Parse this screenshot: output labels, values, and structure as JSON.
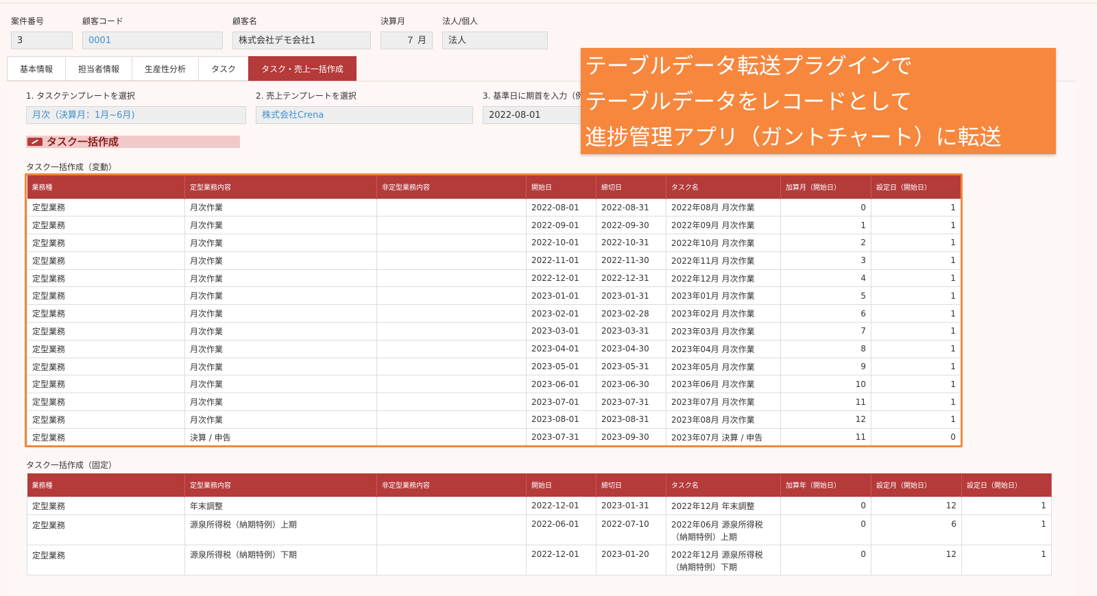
{
  "header": {
    "case_no": {
      "label": "案件番号",
      "value": "3"
    },
    "customer_code": {
      "label": "顧客コード",
      "value": "0001"
    },
    "customer_name": {
      "label": "顧客名",
      "value": "株式会社デモ会社1"
    },
    "closing_month": {
      "label": "決算月",
      "value": "７ 月"
    },
    "entity_type": {
      "label": "法人/個人",
      "value": "法人"
    }
  },
  "tabs": [
    "基本情報",
    "担当者情報",
    "生産性分析",
    "タスク",
    "タスク・売上一括作成"
  ],
  "selectors": {
    "task_template": {
      "label": "1. タスクテンプレートを選択",
      "value": "月次（決算月：1月~6月)"
    },
    "sales_template": {
      "label": "2. 売上テンプレートを選択",
      "value": "株式会社Crena"
    },
    "base_date": {
      "label": "3. 基準日に期首を入力（例",
      "value": "2022-08-01"
    }
  },
  "section_title": "タスク一括作成",
  "callout": {
    "line1": "テーブルデータ転送プラグインで",
    "line2": "テーブルデータをレコードとして",
    "line3": "進捗管理アプリ（ガントチャート）に転送"
  },
  "table_variable": {
    "caption": "タスク一括作成（変動）",
    "headers": [
      "業務種",
      "定型業務内容",
      "非定型業務内容",
      "開始日",
      "締切日",
      "タスク名",
      "加算月（開始日）",
      "設定日（開始日）"
    ],
    "rows": [
      [
        "定型業務",
        "月次作業",
        "",
        "2022-08-01",
        "2022-08-31",
        "2022年08月 月次作業",
        "0",
        "1"
      ],
      [
        "定型業務",
        "月次作業",
        "",
        "2022-09-01",
        "2022-09-30",
        "2022年09月 月次作業",
        "1",
        "1"
      ],
      [
        "定型業務",
        "月次作業",
        "",
        "2022-10-01",
        "2022-10-31",
        "2022年10月 月次作業",
        "2",
        "1"
      ],
      [
        "定型業務",
        "月次作業",
        "",
        "2022-11-01",
        "2022-11-30",
        "2022年11月 月次作業",
        "3",
        "1"
      ],
      [
        "定型業務",
        "月次作業",
        "",
        "2022-12-01",
        "2022-12-31",
        "2022年12月 月次作業",
        "4",
        "1"
      ],
      [
        "定型業務",
        "月次作業",
        "",
        "2023-01-01",
        "2023-01-31",
        "2023年01月 月次作業",
        "5",
        "1"
      ],
      [
        "定型業務",
        "月次作業",
        "",
        "2023-02-01",
        "2023-02-28",
        "2023年02月 月次作業",
        "6",
        "1"
      ],
      [
        "定型業務",
        "月次作業",
        "",
        "2023-03-01",
        "2023-03-31",
        "2023年03月 月次作業",
        "7",
        "1"
      ],
      [
        "定型業務",
        "月次作業",
        "",
        "2023-04-01",
        "2023-04-30",
        "2023年04月 月次作業",
        "8",
        "1"
      ],
      [
        "定型業務",
        "月次作業",
        "",
        "2023-05-01",
        "2023-05-31",
        "2023年05月 月次作業",
        "9",
        "1"
      ],
      [
        "定型業務",
        "月次作業",
        "",
        "2023-06-01",
        "2023-06-30",
        "2023年06月 月次作業",
        "10",
        "1"
      ],
      [
        "定型業務",
        "月次作業",
        "",
        "2023-07-01",
        "2023-07-31",
        "2023年07月 月次作業",
        "11",
        "1"
      ],
      [
        "定型業務",
        "月次作業",
        "",
        "2023-08-01",
        "2023-08-31",
        "2023年08月 月次作業",
        "12",
        "1"
      ],
      [
        "定型業務",
        "決算 / 申告",
        "",
        "2023-07-31",
        "2023-09-30",
        "2023年07月 決算 / 申告",
        "11",
        "0"
      ]
    ]
  },
  "table_fixed": {
    "caption": "タスク一括作成（固定）",
    "headers": [
      "業務種",
      "定型業務内容",
      "非定型業務内容",
      "開始日",
      "締切日",
      "タスク名",
      "加算年（開始日）",
      "設定月（開始日）",
      "設定日（開始日）"
    ],
    "rows": [
      [
        "定型業務",
        "年末調整",
        "",
        "2022-12-01",
        "2023-01-31",
        "2022年12月 年末調整",
        "0",
        "12",
        "1"
      ],
      [
        "定型業務",
        "源泉所得税（納期特例）上期",
        "",
        "2022-06-01",
        "2022-07-10",
        "2022年06月 源泉所得税（納期特例）上期",
        "0",
        "6",
        "1"
      ],
      [
        "定型業務",
        "源泉所得税（納期特例）下期",
        "",
        "2022-12-01",
        "2023-01-20",
        "2022年12月 源泉所得税（納期特例）下期",
        "0",
        "12",
        "1"
      ]
    ]
  }
}
